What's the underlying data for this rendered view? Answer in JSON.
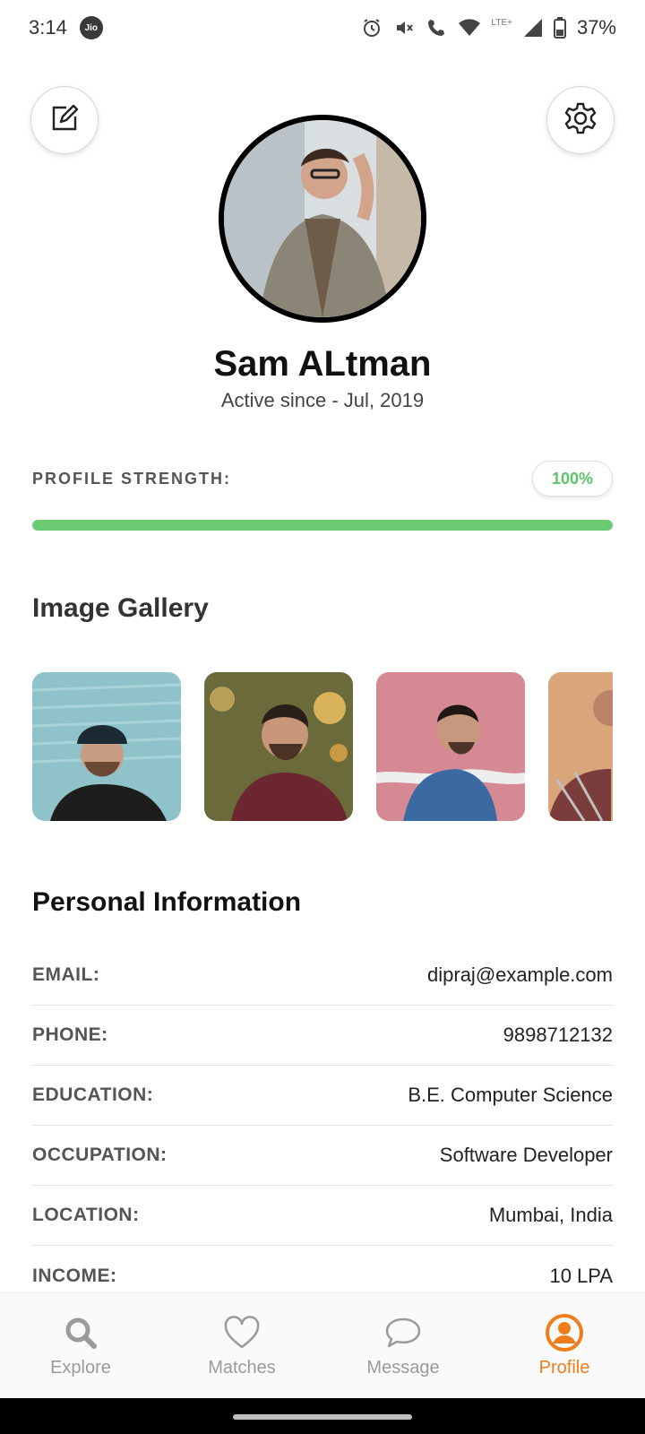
{
  "status_bar": {
    "time": "3:14",
    "carrier_badge": "Jio",
    "lte": "LTE+",
    "battery": "37%"
  },
  "header": {
    "edit_icon": "edit-icon",
    "settings_icon": "gear-icon"
  },
  "profile": {
    "name": "Sam ALtman",
    "active_since": "Active since - Jul, 2019",
    "strength_label": "PROFILE STRENGTH:",
    "strength_value": "100%",
    "strength_fraction": 1.0
  },
  "gallery": {
    "title": "Image Gallery",
    "image_count_visible": 4
  },
  "personal_info": {
    "title": "Personal Information",
    "rows": [
      {
        "key": "EMAIL:",
        "value": "dipraj@example.com"
      },
      {
        "key": "PHONE:",
        "value": "9898712132"
      },
      {
        "key": "EDUCATION:",
        "value": "B.E. Computer Science"
      },
      {
        "key": "OCCUPATION:",
        "value": "Software Developer"
      },
      {
        "key": "LOCATION:",
        "value": "Mumbai, India"
      },
      {
        "key": "INCOME:",
        "value": "10 LPA"
      }
    ]
  },
  "nav": {
    "items": [
      {
        "label": "Explore",
        "icon": "search-icon",
        "active": false
      },
      {
        "label": "Matches",
        "icon": "heart-icon",
        "active": false
      },
      {
        "label": "Message",
        "icon": "chat-icon",
        "active": false
      },
      {
        "label": "Profile",
        "icon": "profile-icon",
        "active": true
      }
    ]
  },
  "colors": {
    "accent": "#f07d1a",
    "success": "#6acb72",
    "success_text": "#5cc46a"
  }
}
